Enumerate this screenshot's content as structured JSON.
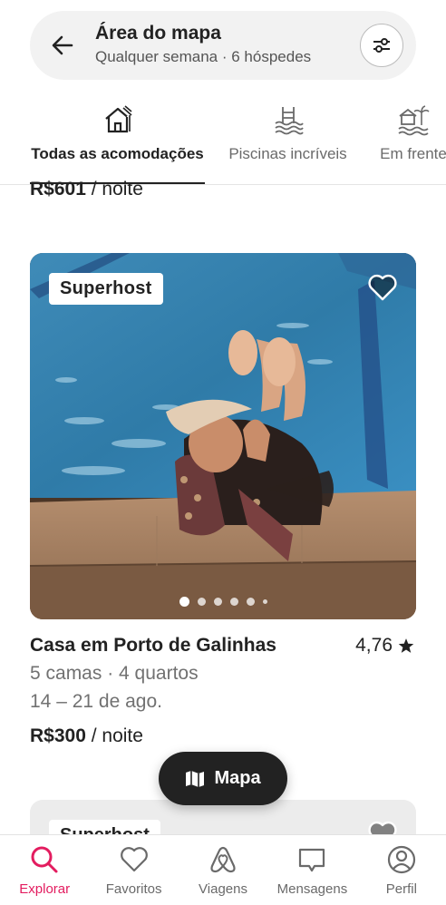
{
  "search": {
    "title": "Área do mapa",
    "subtitle": "Qualquer semana · 6 hóspedes"
  },
  "categories": [
    {
      "label": "Todas as acomodações",
      "icon": "house-icon",
      "active": true
    },
    {
      "label": "Piscinas incríveis",
      "icon": "pool-icon",
      "active": false
    },
    {
      "label": "Em frente",
      "icon": "beachfront-icon",
      "active": false
    }
  ],
  "prev_listing": {
    "price": "R$601",
    "price_unit": " / noite"
  },
  "listing": {
    "badge": "Superhost",
    "title": "Casa em Porto de Galinhas",
    "rating": "4,76",
    "beds": "5 camas · 4 quartos",
    "dates": "14 – 21 de ago.",
    "price": "R$300",
    "price_unit": " / noite",
    "photo_index": 1,
    "photo_count_dots": 6
  },
  "next_listing": {
    "badge": "Superhost"
  },
  "map_button": {
    "label": "Mapa"
  },
  "bottom_nav": [
    {
      "label": "Explorar",
      "icon": "search-icon",
      "active": true
    },
    {
      "label": "Favoritos",
      "icon": "heart-icon",
      "active": false
    },
    {
      "label": "Viagens",
      "icon": "airbnb-logo-icon",
      "active": false
    },
    {
      "label": "Mensagens",
      "icon": "message-icon",
      "active": false
    },
    {
      "label": "Perfil",
      "icon": "profile-icon",
      "active": false
    }
  ],
  "colors": {
    "accent": "#e31c5f",
    "text": "#222222",
    "muted": "#717171"
  }
}
